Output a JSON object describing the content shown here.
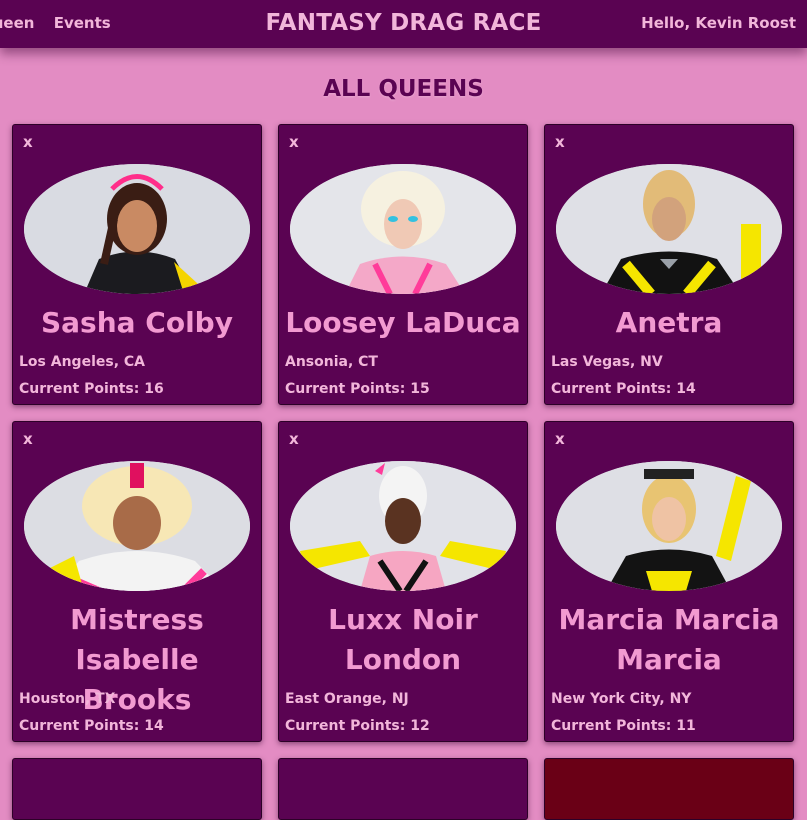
{
  "nav": {
    "links": [
      "Queen",
      "Events"
    ],
    "site_title": "FANTASY DRAG RACE",
    "greeting": "Hello, Kevin Roost"
  },
  "page": {
    "heading": "ALL QUEENS"
  },
  "queens": [
    {
      "name": "Sasha Colby",
      "location": "Los Angeles, CA",
      "points_label": "Current Points: 16",
      "remove_label": "x"
    },
    {
      "name": "Loosey LaDuca",
      "location": "Ansonia, CT",
      "points_label": "Current Points: 15",
      "remove_label": "x"
    },
    {
      "name": "Anetra",
      "location": "Las Vegas, NV",
      "points_label": "Current Points: 14",
      "remove_label": "x"
    },
    {
      "name": "Mistress Isabelle Brooks",
      "location": "Houston, TX",
      "points_label": "Current Points: 14",
      "remove_label": "x"
    },
    {
      "name": "Luxx Noir London",
      "location": "East Orange, NJ",
      "points_label": "Current Points: 12",
      "remove_label": "x"
    },
    {
      "name": "Marcia Marcia Marcia",
      "location": "New York City, NY",
      "points_label": "Current Points: 11",
      "remove_label": "x"
    }
  ],
  "colors": {
    "page_bg": "#e38cc3",
    "nav_bg": "#5a0352",
    "card_bg": "#5a0352",
    "name_color": "#f29ad1",
    "text_color": "#f2b6da"
  }
}
